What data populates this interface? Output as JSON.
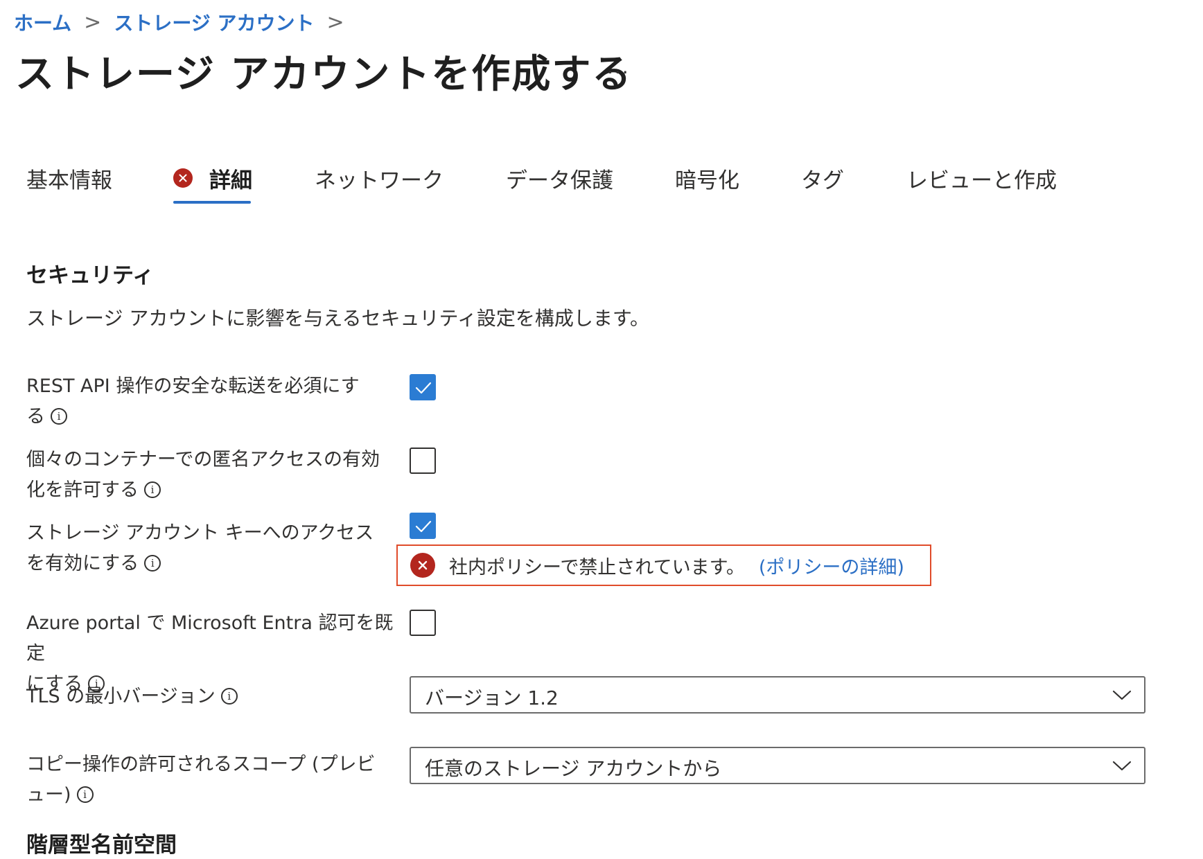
{
  "breadcrumb": {
    "home": "ホーム",
    "storage_accounts": "ストレージ アカウント",
    "separator": ">"
  },
  "page": {
    "title": "ストレージ アカウントを作成する",
    "more": "..."
  },
  "tabs": [
    {
      "label": "基本情報",
      "active": false,
      "error": false
    },
    {
      "label": "詳細",
      "active": true,
      "error": true
    },
    {
      "label": "ネットワーク",
      "active": false,
      "error": false
    },
    {
      "label": "データ保護",
      "active": false,
      "error": false
    },
    {
      "label": "暗号化",
      "active": false,
      "error": false
    },
    {
      "label": "タグ",
      "active": false,
      "error": false
    },
    {
      "label": "レビューと作成",
      "active": false,
      "error": false
    }
  ],
  "security": {
    "title": "セキュリティ",
    "description": "ストレージ アカウントに影響を与えるセキュリティ設定を構成します。",
    "fields": {
      "secure_transfer": {
        "label_line1": "REST API 操作の安全な転送を必須にす",
        "label_line2": "る",
        "checked": true
      },
      "anonymous_access": {
        "label_line1": "個々のコンテナーでの匿名アクセスの有効",
        "label_line2": "化を許可する",
        "checked": false
      },
      "key_access": {
        "label_line1": "ストレージ アカウント キーへのアクセス",
        "label_line2": "を有効にする",
        "checked": true,
        "error_message": "社内ポリシーで禁止されています。",
        "error_link": "(ポリシーの詳細)"
      },
      "entra_auth": {
        "label_line1": "Azure portal で Microsoft Entra 認可を既定",
        "label_line2": "にする",
        "checked": false
      },
      "tls_version": {
        "label": "TLS の最小バージョン",
        "value": "バージョン 1.2"
      },
      "copy_scope": {
        "label_line1": "コピー操作の許可されるスコープ (プレビ",
        "label_line2": "ュー)",
        "value": "任意のストレージ アカウントから"
      }
    },
    "info_glyph": "i"
  },
  "next_section": {
    "title": "階層型名前空間"
  },
  "colors": {
    "accent": "#2b6fc5",
    "checkbox_fill": "#2b7cd3",
    "error_red": "#b3261e",
    "error_border": "#e04b2a"
  },
  "icons": {
    "error": "error-circle-icon",
    "info": "info-icon",
    "check": "checkmark-icon",
    "chevron": "chevron-down-icon",
    "separator": "chevron-right-icon"
  }
}
